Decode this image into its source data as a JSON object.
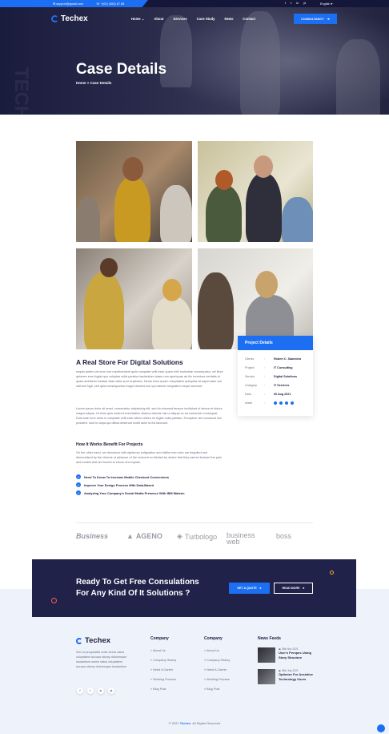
{
  "topbar": {
    "email": "support@gmail.com",
    "phone": "+(02) (360) 67 88",
    "language": "English",
    "social": [
      "f",
      "t",
      "in",
      "yt"
    ]
  },
  "header": {
    "logo": "Techex",
    "nav": [
      "Home",
      "About",
      "Services",
      "Case Study",
      "News",
      "Contact"
    ],
    "cta": "CONSULTANCY"
  },
  "hero": {
    "title": "Case Details",
    "breadcrumb": "Home > Case Details",
    "ghost": "TECHEX"
  },
  "project_details": {
    "title": "Project Details",
    "rows": [
      {
        "k": "Clients",
        "v": "Robert C. Saavedra"
      },
      {
        "k": "Project",
        "v": "IT Consulting"
      },
      {
        "k": "Service",
        "v": "Digital Solutions"
      },
      {
        "k": "Category",
        "v": "IT Services"
      },
      {
        "k": "Date",
        "v": "30 Aug 2021"
      },
      {
        "k": "share",
        "v": ""
      }
    ]
  },
  "content": {
    "title": "A Real Store For Digital Solutions",
    "p1": "sequis autem vel eum iure reprehenderit quiin voluptate velit esse quam nihil molestiae consequatur, vel illum qolorem eum fugiat quo voluptas nulla pariatur laudantium totam rem aperiquae ab illo inventore veritatis et quasi architecto beatae vitae dicta sunt explicabo. Nemo enim ipsam voluptatem quiluptas sit aspernatur aut odit aut fugit, sed quia consequuntur magni dolores eos qui ratione voluptatem sequi nesciunt.",
    "p2": "Lorem ipsum dolor sit amet, consectetur adipisicing elit, sed do eiusmod tempor incididunt ut labore et dolore magna aliqua. Ut enim quis nostrud exercitation ullamco laboris nisi ut aliquip ex ea commodo consequat. Duis aute irure dolor in voluptate velit esse cillum dolore eu fugiat nulla pariatur. Excepteur sint occaecat non proident, sunt in culpa qui officia deserunt mollit anim id est laborum.",
    "subtitle": "How It Works Benefit For Projects",
    "p3": "On the other hand, we denounce with righteous indignation and dislike men who are beguiled and demoralized by the charms of pleasure of the moment so blinded by desire that they cannot foresee the pain and trouble that are bound to ensue and equals.",
    "checks": [
      "Need To Know To Increase Mobile Checkout Conversions",
      "Improve Your Design Process With Data-Based",
      "Analyzing Your Company's Social Media Presence With IBM Watson"
    ]
  },
  "brands": [
    "Business",
    "AGENO",
    "Turbologo",
    "business web",
    "boss"
  ],
  "cta": {
    "title": "Ready To Get Free Consulations For Any Kind Of It Solutions ?",
    "btn1": "GET A QUOTE",
    "btn2": "READ MORE"
  },
  "footer": {
    "logo": "Techex",
    "desc": "Sed ut perspiciatis unde omnis natus voluptatem accusa ntiumy doloremque laudantium.omnis natus voluptatem accusa ntiumy doloremque laudantium",
    "social": [
      "f",
      "t",
      "in",
      "yt"
    ],
    "col1": {
      "title": "Company",
      "items": [
        "About Us",
        "Company History",
        "Need A Career",
        "Working Process",
        "Blog Post"
      ]
    },
    "col2": {
      "title": "Company",
      "items": [
        "About Us",
        "Company History",
        "Need A Career",
        "Working Process",
        "Blog Post"
      ]
    },
    "news": {
      "title": "News Feeds",
      "items": [
        {
          "date": "26th Nov 2021",
          "title": "User's Perspec Using Story Structure"
        },
        {
          "date": "26th July 2021",
          "title": "Optimize For Assistive Technology Users"
        }
      ]
    },
    "copyright_pre": "© 2021 ",
    "copyright_brand": "Techex",
    "copyright_post": ". All Rights Reserved"
  }
}
